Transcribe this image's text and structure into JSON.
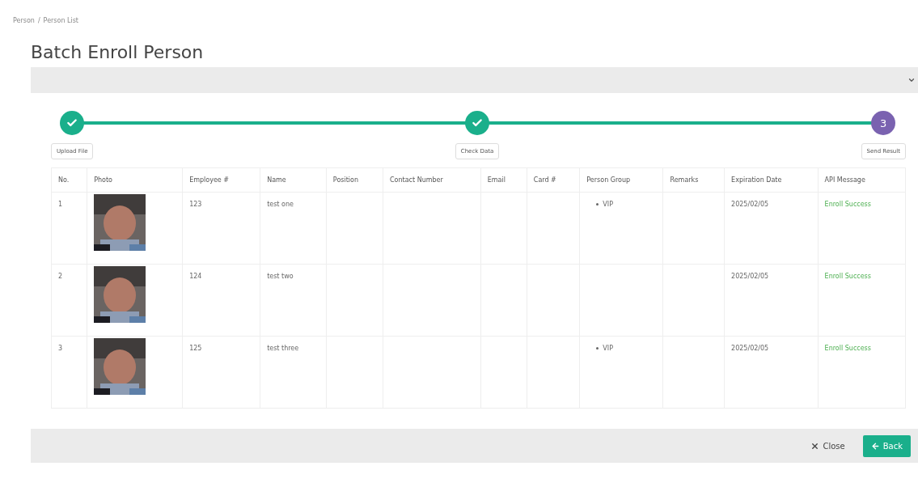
{
  "breadcrumb": {
    "items": [
      "Person",
      "Person List"
    ],
    "separator": "/"
  },
  "title": "Batch Enroll Person",
  "collapse_bar": {
    "expanded": false
  },
  "steps": [
    {
      "label": "Upload File",
      "kind": "done"
    },
    {
      "label": "Check Data",
      "kind": "done"
    },
    {
      "label": "Send Result",
      "kind": "current",
      "number": "3"
    }
  ],
  "table": {
    "columns": [
      "No.",
      "Photo",
      "Employee #",
      "Name",
      "Position",
      "Contact Number",
      "Email",
      "Card #",
      "Person Group",
      "Remarks",
      "Expiration Date",
      "API Message"
    ],
    "rows": [
      {
        "no": "1",
        "photo": {
          "kind": "picture"
        },
        "employee": "123",
        "name": "test one",
        "person_group": [
          "VIP"
        ],
        "expiration_date": "2025/02/05",
        "api_message": "Enroll Success"
      },
      {
        "no": "2",
        "photo": {
          "kind": "picture"
        },
        "employee": "124",
        "name": "test two",
        "person_group": [],
        "expiration_date": "2025/02/05",
        "api_message": "Enroll Success"
      },
      {
        "no": "3",
        "photo": {
          "kind": "picture"
        },
        "employee": "125",
        "name": "test three",
        "person_group": [
          "VIP"
        ],
        "expiration_date": "2025/02/05",
        "api_message": "Enroll Success"
      }
    ]
  },
  "footer_buttons": [
    {
      "label": "Close",
      "kind": "close"
    },
    {
      "label": "Back",
      "kind": "back"
    }
  ]
}
